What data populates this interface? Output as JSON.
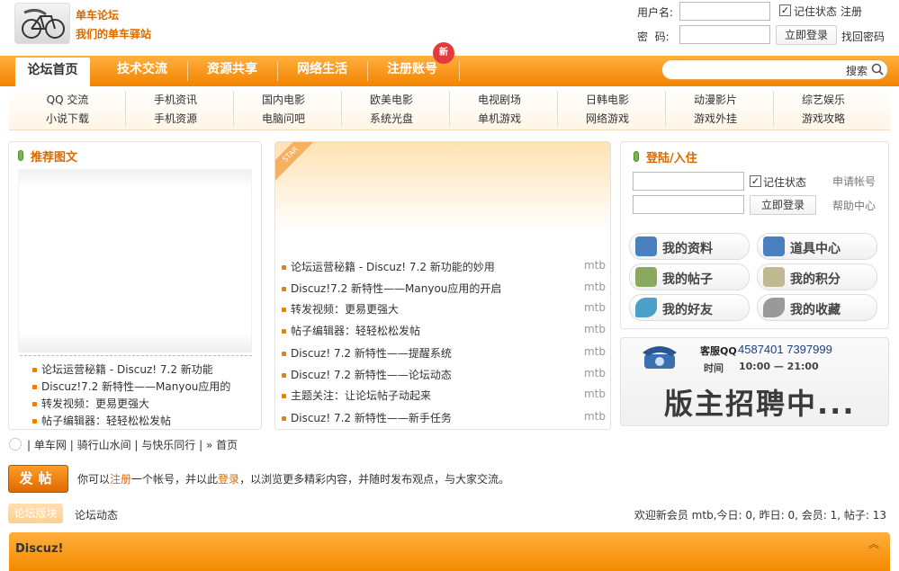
{
  "header": {
    "site_name": "单车论坛",
    "slogan": "我们的单车驿站",
    "username_label": "用户名:",
    "password_label": "密  码:",
    "remember_label": "记住状态",
    "register_link": "注册",
    "login_button": "立即登录",
    "forgot_link": "找回密码"
  },
  "nav": {
    "tabs": [
      {
        "label": "论坛首页"
      },
      {
        "label": "技术交流"
      },
      {
        "label": "资源共享"
      },
      {
        "label": "网络生活"
      },
      {
        "label": "注册账号"
      }
    ],
    "new_badge": "新",
    "search_label": "搜索"
  },
  "subnav": {
    "row1": [
      "QQ 交流",
      "手机资讯",
      "国内电影",
      "欧美电影",
      "电视剧场",
      "日韩电影",
      "动漫影片",
      "综艺娱乐"
    ],
    "row2": [
      "小说下载",
      "手机资源",
      "电脑问吧",
      "系统光盘",
      "单机游戏",
      "网络游戏",
      "游戏外挂",
      "游戏攻略"
    ]
  },
  "recommend": {
    "title": "推荐图文",
    "items": [
      "论坛运营秘籍 - Discuz! 7.2 新功能",
      "Discuz!7.2 新特性——Manyou应用的",
      "转发视频：更易更强大",
      "帖子编辑器：轻轻松松发帖"
    ]
  },
  "center": {
    "star_label": "STAR",
    "threads": [
      {
        "title": "论坛运营秘籍 - Discuz! 7.2 新功能的妙用",
        "author": "mtb"
      },
      {
        "title": "Discuz!7.2 新特性——Manyou应用的开启",
        "author": "mtb"
      },
      {
        "title": "转发视频：更易更强大",
        "author": "mtb"
      },
      {
        "title": "帖子编辑器：轻轻松松发帖",
        "author": "mtb"
      },
      {
        "title": "Discuz! 7.2 新特性——提醒系统",
        "author": "mtb"
      },
      {
        "title": "Discuz! 7.2 新特性——论坛动态",
        "author": "mtb"
      },
      {
        "title": "主题关注：让论坛帖子动起来",
        "author": "mtb"
      },
      {
        "title": "Discuz! 7.2 新特性——新手任务",
        "author": "mtb"
      }
    ]
  },
  "login": {
    "title": "登陆/入住",
    "remember_label": "记住状态",
    "apply_link": "申请帐号",
    "login_button": "立即登录",
    "help_link": "帮助中心",
    "buttons": [
      {
        "label": "我的资料",
        "icon": "user-icon",
        "color": "#4a7fc0"
      },
      {
        "label": "道具中心",
        "icon": "pen-icon",
        "color": "#4a7fc0"
      },
      {
        "label": "我的帖子",
        "icon": "picture-icon",
        "color": "#8aa860"
      },
      {
        "label": "我的积分",
        "icon": "document-icon",
        "color": "#c0b890"
      },
      {
        "label": "我的好友",
        "icon": "leaf-icon",
        "color": "#4aa0c8"
      },
      {
        "label": "我的收藏",
        "icon": "leaf-gray-icon",
        "color": "#999999"
      }
    ]
  },
  "ad": {
    "qq_label": "客服QQ",
    "qq_numbers": "4587401  7397999",
    "time_label": "时间",
    "time_value": "10:00 — 21:00",
    "banner_text": "版主招聘中..."
  },
  "breadcrumb": {
    "items": [
      "单车网",
      "骑行山水间",
      "与快乐同行"
    ],
    "current": "» 首页"
  },
  "notice": {
    "post_button": "发帖",
    "text_before": "你可以",
    "register": "注册",
    "text_mid": "一个帐号，并以此",
    "login": "登录",
    "text_after": "，以浏览更多精彩内容，并随时发布观点，与大家交流。"
  },
  "tabs2": {
    "active": "论坛版块",
    "other": "论坛动态"
  },
  "stats": {
    "text": "欢迎新会员 mtb,今日: 0, 昨日: 0, 会员: 1, 帖子: 13"
  },
  "forum_section": {
    "title": "Discuz!"
  },
  "colors": {
    "accent": "#f28300",
    "brand_text": "#d86a00"
  }
}
